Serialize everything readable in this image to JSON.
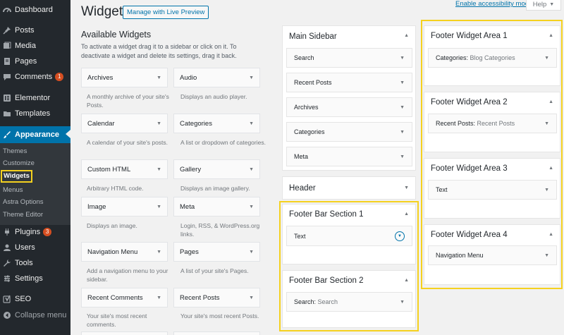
{
  "admin_menu": {
    "dashboard": "Dashboard",
    "posts": "Posts",
    "media": "Media",
    "pages": "Pages",
    "comments": "Comments",
    "comments_badge": "1",
    "elementor": "Elementor",
    "templates": "Templates",
    "appearance": "Appearance",
    "submenu": [
      "Themes",
      "Customize",
      "Widgets",
      "Menus",
      "Astra Options",
      "Theme Editor"
    ],
    "plugins": "Plugins",
    "plugins_badge": "3",
    "users": "Users",
    "tools": "Tools",
    "settings": "Settings",
    "seo": "SEO",
    "collapse": "Collapse menu"
  },
  "header": {
    "title": "Widgets",
    "live_preview": "Manage with Live Preview",
    "accessibility": "Enable accessibility mode",
    "help": "Help"
  },
  "available": {
    "title": "Available Widgets",
    "description": "To activate a widget drag it to a sidebar or click on it. To deactivate a widget and delete its settings, drag it back.",
    "widgets": [
      {
        "name": "Archives",
        "desc": "A monthly archive of your site's Posts."
      },
      {
        "name": "Audio",
        "desc": "Displays an audio player."
      },
      {
        "name": "Calendar",
        "desc": "A calendar of your site's posts."
      },
      {
        "name": "Categories",
        "desc": "A list or dropdown of categories."
      },
      {
        "name": "Custom HTML",
        "desc": "Arbitrary HTML code."
      },
      {
        "name": "Gallery",
        "desc": "Displays an image gallery."
      },
      {
        "name": "Image",
        "desc": "Displays an image."
      },
      {
        "name": "Meta",
        "desc": "Login, RSS, & WordPress.org links."
      },
      {
        "name": "Navigation Menu",
        "desc": "Add a navigation menu to your sidebar."
      },
      {
        "name": "Pages",
        "desc": "A list of your site's Pages."
      },
      {
        "name": "Recent Comments",
        "desc": "Your site's most recent comments."
      },
      {
        "name": "Recent Posts",
        "desc": "Your site's most recent Posts."
      }
    ]
  },
  "main_sidebar": {
    "title": "Main Sidebar",
    "widgets": [
      "Search",
      "Recent Posts",
      "Archives",
      "Categories",
      "Meta"
    ]
  },
  "header_area": {
    "title": "Header"
  },
  "footer_bar_1": {
    "title": "Footer Bar Section 1",
    "widget": "Text"
  },
  "footer_bar_2": {
    "title": "Footer Bar Section 2",
    "widget_name": "Search",
    "widget_title": "Search"
  },
  "footer_area_1": {
    "title": "Footer Widget Area 1",
    "widget_name": "Categories",
    "widget_title": "Blog Categories"
  },
  "footer_area_2": {
    "title": "Footer Widget Area 2",
    "widget_name": "Recent Posts",
    "widget_title": "Recent Posts"
  },
  "footer_area_3": {
    "title": "Footer Widget Area 3",
    "widget": "Text"
  },
  "footer_area_4": {
    "title": "Footer Widget Area 4",
    "widget": "Navigation Menu"
  },
  "colors": {
    "accent": "#0073aa",
    "highlight": "#f5d11f",
    "menu_bg": "#23282d",
    "badge": "#d54e21"
  }
}
